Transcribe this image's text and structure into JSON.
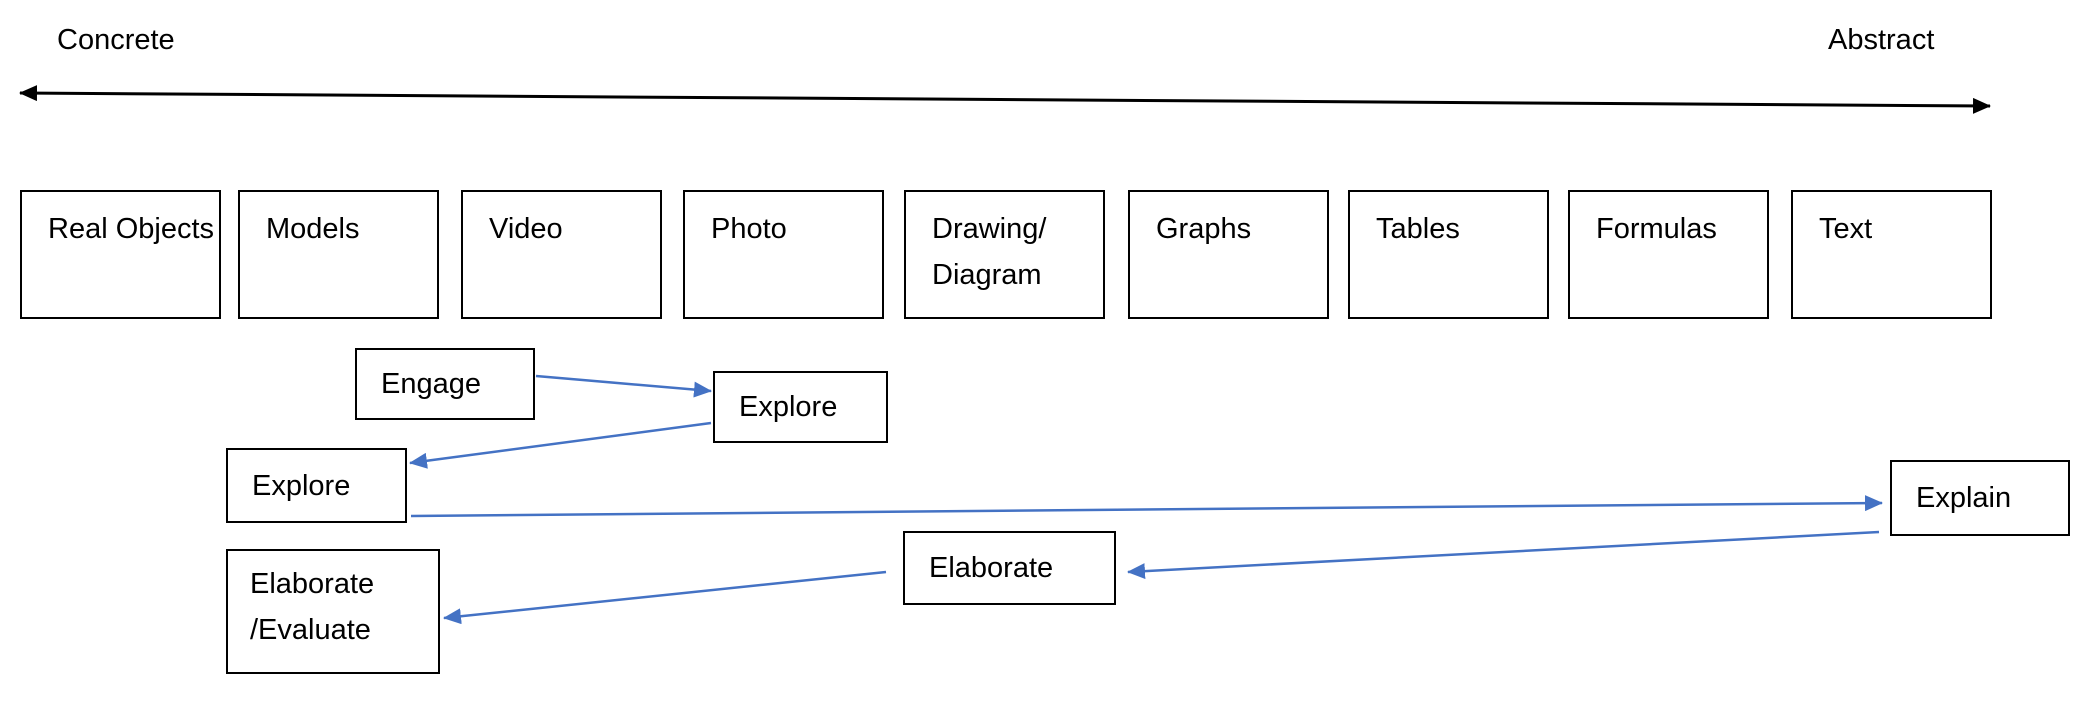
{
  "axis": {
    "left_label": "Concrete",
    "right_label": "Abstract"
  },
  "representations": [
    "Real Objects",
    "Models",
    "Video",
    "Photo",
    "Drawing/ Diagram",
    "Graphs",
    "Tables",
    "Formulas",
    "Text"
  ],
  "stages": {
    "engage": "Engage",
    "explore_1": "Explore",
    "explore_2": "Explore",
    "explain": "Explain",
    "elaborate": "Elaborate",
    "elaborate_evaluate": "Elaborate /Evaluate"
  },
  "flow": [
    {
      "from": "Engage",
      "to": "Explore"
    },
    {
      "from": "Explore",
      "to": "Explore"
    },
    {
      "from": "Explore",
      "to": "Explain"
    },
    {
      "from": "Explain",
      "to": "Elaborate"
    },
    {
      "from": "Elaborate",
      "to": "Elaborate /Evaluate"
    }
  ],
  "colors": {
    "axis": "#000000",
    "flow_arrow": "#4472C4"
  }
}
